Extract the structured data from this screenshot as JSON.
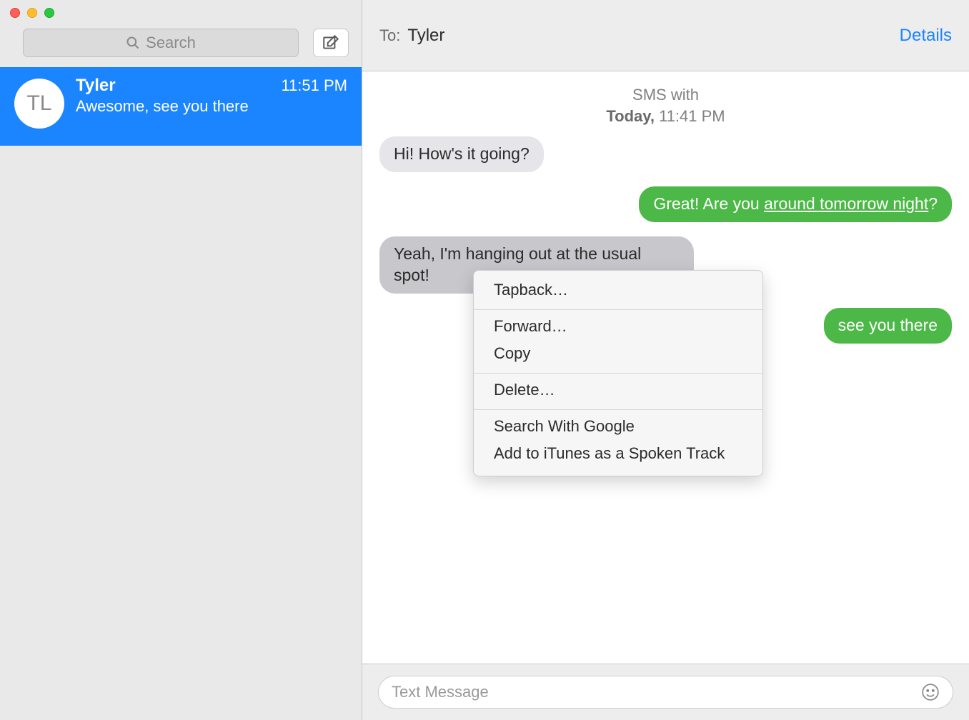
{
  "sidebar": {
    "search_placeholder": "Search",
    "conversation": {
      "initials": "TL",
      "name": "Tyler",
      "time": "11:51 PM",
      "preview": "Awesome, see you there"
    }
  },
  "header": {
    "to_label": "To:",
    "to_name": "Tyler",
    "details": "Details"
  },
  "meta": {
    "line1": "SMS with",
    "line2_day": "Today,",
    "line2_time": " 11:41 PM"
  },
  "messages": {
    "m1": "Hi! How's it going?",
    "m2_a": "Great! Are you ",
    "m2_b": "around tomorrow night",
    "m2_c": "?",
    "m3": "Yeah, I'm hanging out at the usual spot!",
    "m4": "see you there"
  },
  "context_menu": {
    "tapback": "Tapback…",
    "forward": "Forward…",
    "copy": "Copy",
    "delete": "Delete…",
    "search_google": "Search With Google",
    "add_itunes": "Add to iTunes as a Spoken Track"
  },
  "input": {
    "placeholder": "Text Message"
  }
}
